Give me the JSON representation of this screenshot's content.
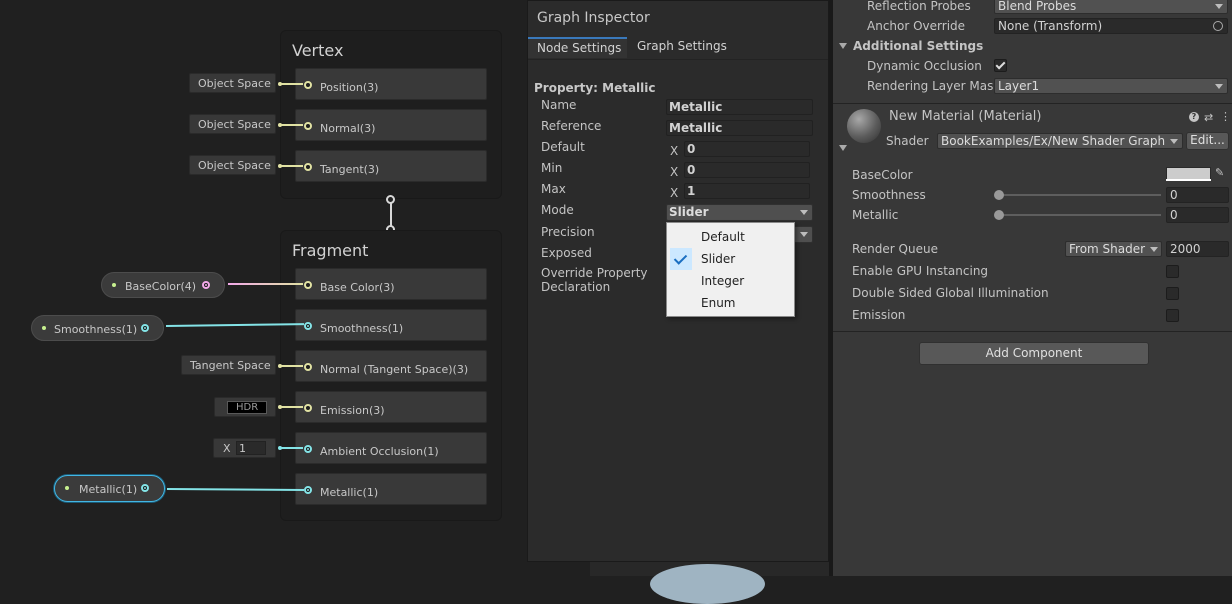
{
  "graph": {
    "vertex": {
      "title": "Vertex",
      "blocks": [
        "Position(3)",
        "Normal(3)",
        "Tangent(3)"
      ],
      "inputs": [
        "Object Space",
        "Object Space",
        "Object Space"
      ]
    },
    "fragment": {
      "title": "Fragment",
      "blocks": [
        "Base Color(3)",
        "Smoothness(1)",
        "Normal (Tangent Space)(3)",
        "Emission(3)",
        "Ambient Occlusion(1)",
        "Metallic(1)"
      ],
      "tangent_input": "Tangent Space",
      "hdr_input": "HDR",
      "ao_x_label": "X",
      "ao_value": "1"
    },
    "properties": [
      "BaseColor(4)",
      "Smoothness(1)",
      "Metallic(1)"
    ]
  },
  "inspector": {
    "title": "Graph Inspector",
    "tabs": [
      "Node Settings",
      "Graph Settings"
    ],
    "heading": "Property: Metallic",
    "labels": {
      "name": "Name",
      "reference": "Reference",
      "default": "Default",
      "min": "Min",
      "max": "Max",
      "mode": "Mode",
      "precision": "Precision",
      "exposed": "Exposed",
      "override1": "Override Property",
      "override2": "Declaration"
    },
    "values": {
      "name": "Metallic",
      "reference": "Metallic",
      "x": "X",
      "default": "0",
      "min": "0",
      "max": "1",
      "mode": "Slider"
    },
    "mode_menu": [
      "Default",
      "Slider",
      "Integer",
      "Enum"
    ]
  },
  "right": {
    "reflection_probes_label": "Reflection Probes",
    "reflection_probes_value": "Blend Probes",
    "anchor_override_label": "Anchor Override",
    "anchor_override_value": "None (Transform)",
    "additional_settings": "Additional Settings",
    "dynamic_occlusion": "Dynamic Occlusion",
    "rendering_layer_mask": "Rendering Layer Mask",
    "rendering_layer_value": "Layer1",
    "material_title": "New Material (Material)",
    "shader_label": "Shader",
    "shader_value": "BookExamples/Ex/New Shader Graph",
    "edit_button": "Edit...",
    "base_color": "BaseColor",
    "smoothness": "Smoothness",
    "smoothness_value": "0",
    "metallic": "Metallic",
    "metallic_value": "0",
    "render_queue": "Render Queue",
    "render_queue_mode": "From Shader",
    "render_queue_value": "2000",
    "gpu_instancing": "Enable GPU Instancing",
    "double_sided_gi": "Double Sided Global Illumination",
    "emission": "Emission",
    "add_component": "Add Component"
  }
}
